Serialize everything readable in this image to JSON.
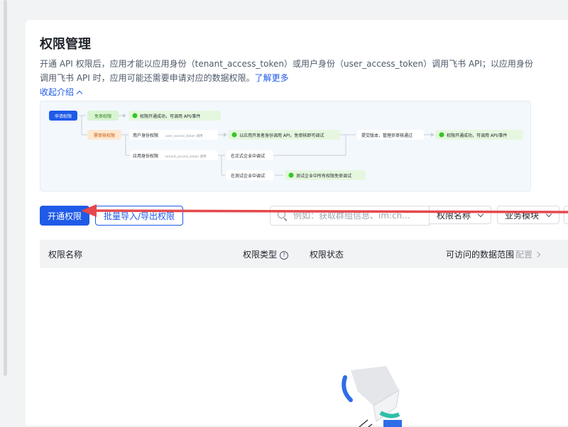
{
  "page": {
    "title": "权限管理",
    "description": "开通 API 权限后，应用才能以应用身份（tenant_access_token）或用户身份（user_access_token）调用飞书 API；以应用身份调用飞书 API 时，应用可能还需要申请对应的数据权限。",
    "learn_more": "了解更多",
    "collapse_label": "收起介绍"
  },
  "diagram": {
    "apply_label": "申请权限",
    "no_review": "免审权限",
    "no_review_result": "权限开通成功，可调用 API/事件",
    "need_review": "需审核权限",
    "user_identity": "用户身份权限",
    "user_identity_token": "user_access_token 调用",
    "user_identity_result": "以应用开发者身份调用 API，免审核即可调试",
    "submit_version": "提交版本，管理员审核通过",
    "final_result": "权限开通成功，可调用 API/事件",
    "app_identity": "应用身份权限",
    "app_identity_token": "tenant_access_token 调用",
    "formal_tenant": "在正式企业中调试",
    "test_tenant": "在测试企业中调试",
    "test_tenant_result": "测试企业中所有权限免审调试"
  },
  "toolbar": {
    "open_button": "开通权限",
    "batch_button": "批量导入/导出权限",
    "search_placeholder": "例如：获取群组信息、im:ch...",
    "perm_select": "权限名称",
    "module_select": "业务模块"
  },
  "table": {
    "columns": [
      "权限名称",
      "权限类型",
      "权限状态",
      "可访问的数据范围"
    ],
    "config_label": "配置"
  },
  "colors": {
    "accent": "#1f5ae8",
    "annotation_arrow": "#e5484d",
    "success": "#34c724",
    "warning_bg": "#ffe8d1"
  }
}
